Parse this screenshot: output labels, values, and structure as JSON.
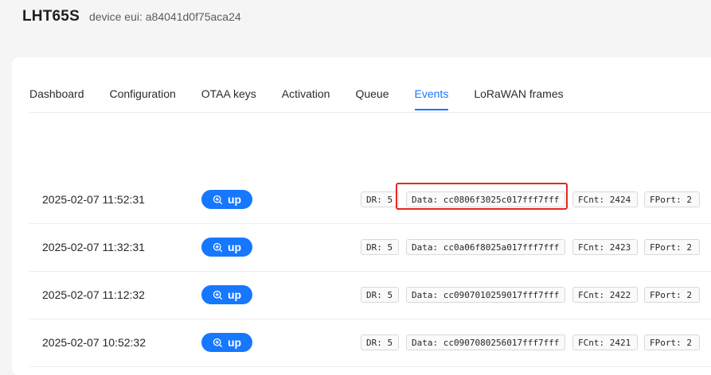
{
  "device": {
    "name": "LHT65S",
    "eui_label": "device eui: a84041d0f75aca24"
  },
  "tabs": [
    {
      "label": "Dashboard"
    },
    {
      "label": "Configuration"
    },
    {
      "label": "OTAA keys"
    },
    {
      "label": "Activation"
    },
    {
      "label": "Queue"
    },
    {
      "label": "Events"
    },
    {
      "label": "LoRaWAN frames"
    }
  ],
  "active_tab": "Events",
  "events": [
    {
      "time": "2025-02-07 11:52:31",
      "type": "up",
      "dr": "DR: 5",
      "data": "Data: cc0806f3025c017fff7fff",
      "fcnt": "FCnt: 2424",
      "fport": "FPort: 2",
      "highlighted": true
    },
    {
      "time": "2025-02-07 11:32:31",
      "type": "up",
      "dr": "DR: 5",
      "data": "Data: cc0a06f8025a017fff7fff",
      "fcnt": "FCnt: 2423",
      "fport": "FPort: 2"
    },
    {
      "time": "2025-02-07 11:12:32",
      "type": "up",
      "dr": "DR: 5",
      "data": "Data: cc0907010259017fff7fff",
      "fcnt": "FCnt: 2422",
      "fport": "FPort: 2"
    },
    {
      "time": "2025-02-07 10:52:32",
      "type": "up",
      "dr": "DR: 5",
      "data": "Data: cc0907080256017fff7fff",
      "fcnt": "FCnt: 2421",
      "fport": "FPort: 2"
    }
  ],
  "colors": {
    "accent": "#1677ff",
    "highlight_border": "#e5261f"
  },
  "icons": {
    "up_button": "zoom-in-icon"
  }
}
